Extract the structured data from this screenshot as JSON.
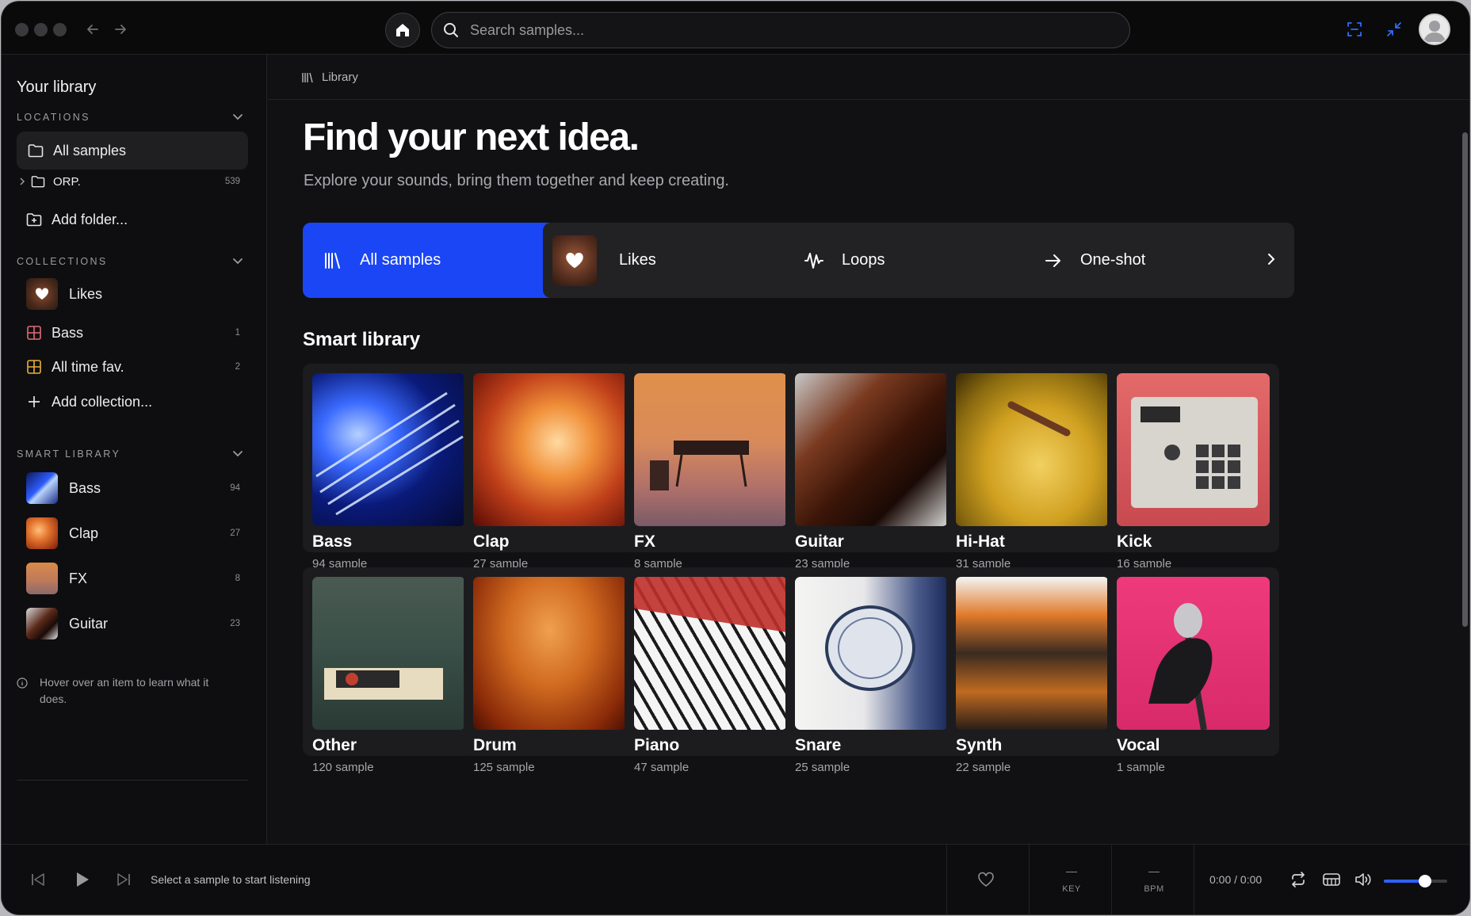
{
  "search": {
    "placeholder": "Search samples..."
  },
  "sidebar": {
    "title": "Your library",
    "locations": {
      "heading": "LOCATIONS",
      "items": [
        {
          "label": "All samples",
          "count": ""
        },
        {
          "label": "ORP.",
          "count": "539"
        },
        {
          "label": "Add folder...",
          "count": ""
        }
      ]
    },
    "collections": {
      "heading": "COLLECTIONS",
      "items": [
        {
          "label": "Likes",
          "count": ""
        },
        {
          "label": "Bass",
          "count": "1"
        },
        {
          "label": "All time fav.",
          "count": "2"
        },
        {
          "label": "Add collection...",
          "count": ""
        }
      ]
    },
    "smart_library": {
      "heading": "SMART LIBRARY",
      "items": [
        {
          "label": "Bass",
          "count": "94"
        },
        {
          "label": "Clap",
          "count": "27"
        },
        {
          "label": "FX",
          "count": "8"
        },
        {
          "label": "Guitar",
          "count": "23"
        }
      ]
    },
    "hint": "Hover over an item to learn what it does."
  },
  "main": {
    "breadcrumb": "Library",
    "headline": "Find your next idea.",
    "subline": "Explore your sounds, bring them together and keep creating.",
    "quick_links": [
      {
        "label": "All samples",
        "icon": "library-icon"
      },
      {
        "label": "Likes",
        "icon": "likes-thumbnail"
      },
      {
        "label": "Loops",
        "icon": "waveform-icon"
      },
      {
        "label": "One-shot",
        "icon": "arrow-right-icon"
      }
    ],
    "smart_library_title": "Smart library",
    "tiles": [
      {
        "name": "Bass",
        "count": "94 sample"
      },
      {
        "name": "Clap",
        "count": "27 sample"
      },
      {
        "name": "FX",
        "count": "8 sample"
      },
      {
        "name": "Guitar",
        "count": "23 sample"
      },
      {
        "name": "Hi-Hat",
        "count": "31 sample"
      },
      {
        "name": "Kick",
        "count": "16 sample"
      },
      {
        "name": "Other",
        "count": "120 sample"
      },
      {
        "name": "Drum",
        "count": "125 sample"
      },
      {
        "name": "Piano",
        "count": "47 sample"
      },
      {
        "name": "Snare",
        "count": "25 sample"
      },
      {
        "name": "Synth",
        "count": "22 sample"
      },
      {
        "name": "Vocal",
        "count": "1 sample"
      }
    ]
  },
  "player": {
    "message": "Select a sample to start listening",
    "key_value": "—",
    "key_label": "KEY",
    "bpm_value": "—",
    "bpm_label": "BPM",
    "time": "0:00 / 0:00",
    "volume": 0.65
  },
  "colors": {
    "accent": "#1b46f5",
    "background": "#111113",
    "sidebar": "#0e0e10",
    "card": "#222225"
  }
}
